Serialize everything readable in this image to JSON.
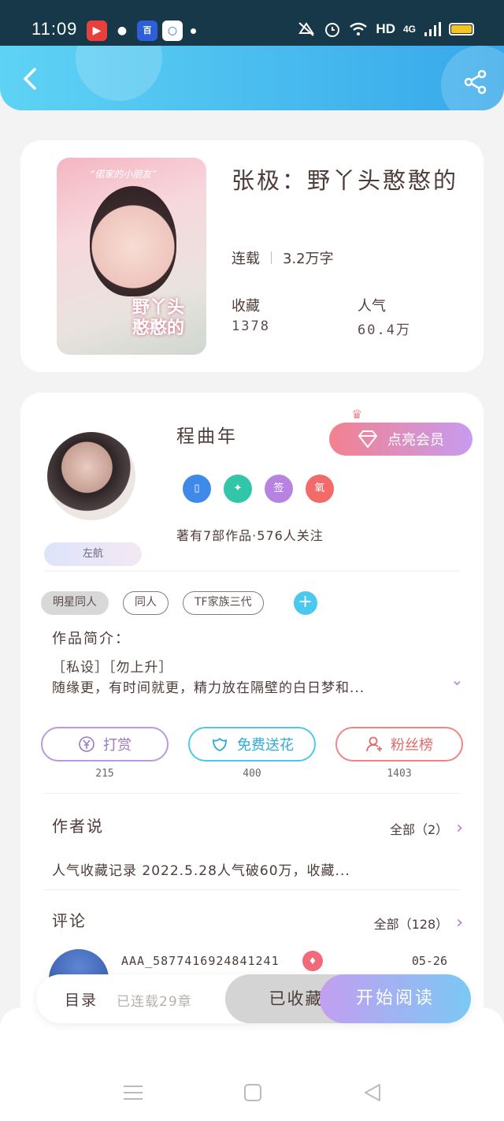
{
  "status_bar": {
    "time": "11:09",
    "network": "HD",
    "signal": "4G"
  },
  "book": {
    "title": "张极：野丫头憨憨的",
    "cover_caption": "“偌家的小朋友”",
    "cover_title": "野丫头 憨憨的",
    "status": "连载",
    "word_count": "3.2万字",
    "favorites_label": "收藏",
    "favorites_value": "1378",
    "popularity_label": "人气",
    "popularity_value": "60.4万"
  },
  "author": {
    "badge": "左航",
    "name": "程曲年",
    "vip_button": "点亮会员",
    "medals": [
      "签",
      "氧"
    ],
    "works": "著有7部作品·576人关注"
  },
  "tags": [
    "明星同人",
    "同人",
    "TF家族三代"
  ],
  "intro": {
    "label": "作品简介：",
    "line1": "［私设］［勿上升］",
    "line2": "随缘更，有时间就更，精力放在隔壁的白日梦和..."
  },
  "actions": [
    {
      "label": "打赏",
      "count": "215",
      "icon": "yen-icon"
    },
    {
      "label": "免费送花",
      "count": "400",
      "icon": "flower-icon"
    },
    {
      "label": "粉丝榜",
      "count": "1403",
      "icon": "user-icon"
    }
  ],
  "author_says": {
    "title": "作者说",
    "all_label": "全部（2）",
    "text": "人气收藏记录 2022.5.28人气破60万，收藏..."
  },
  "comments": {
    "title": "评论",
    "all_label": "全部（128）",
    "first": {
      "username": "AAA_5877416924841241",
      "date": "05-26"
    }
  },
  "bottom_bar": {
    "toc_label": "目录",
    "toc_sub": "已连载29章",
    "collected_label": "已收藏",
    "read_label": "开始阅读"
  },
  "colors": {
    "accent_blue": "#36a8ea",
    "vip_pink": "#f2818f",
    "purple": "#b07ad8"
  }
}
